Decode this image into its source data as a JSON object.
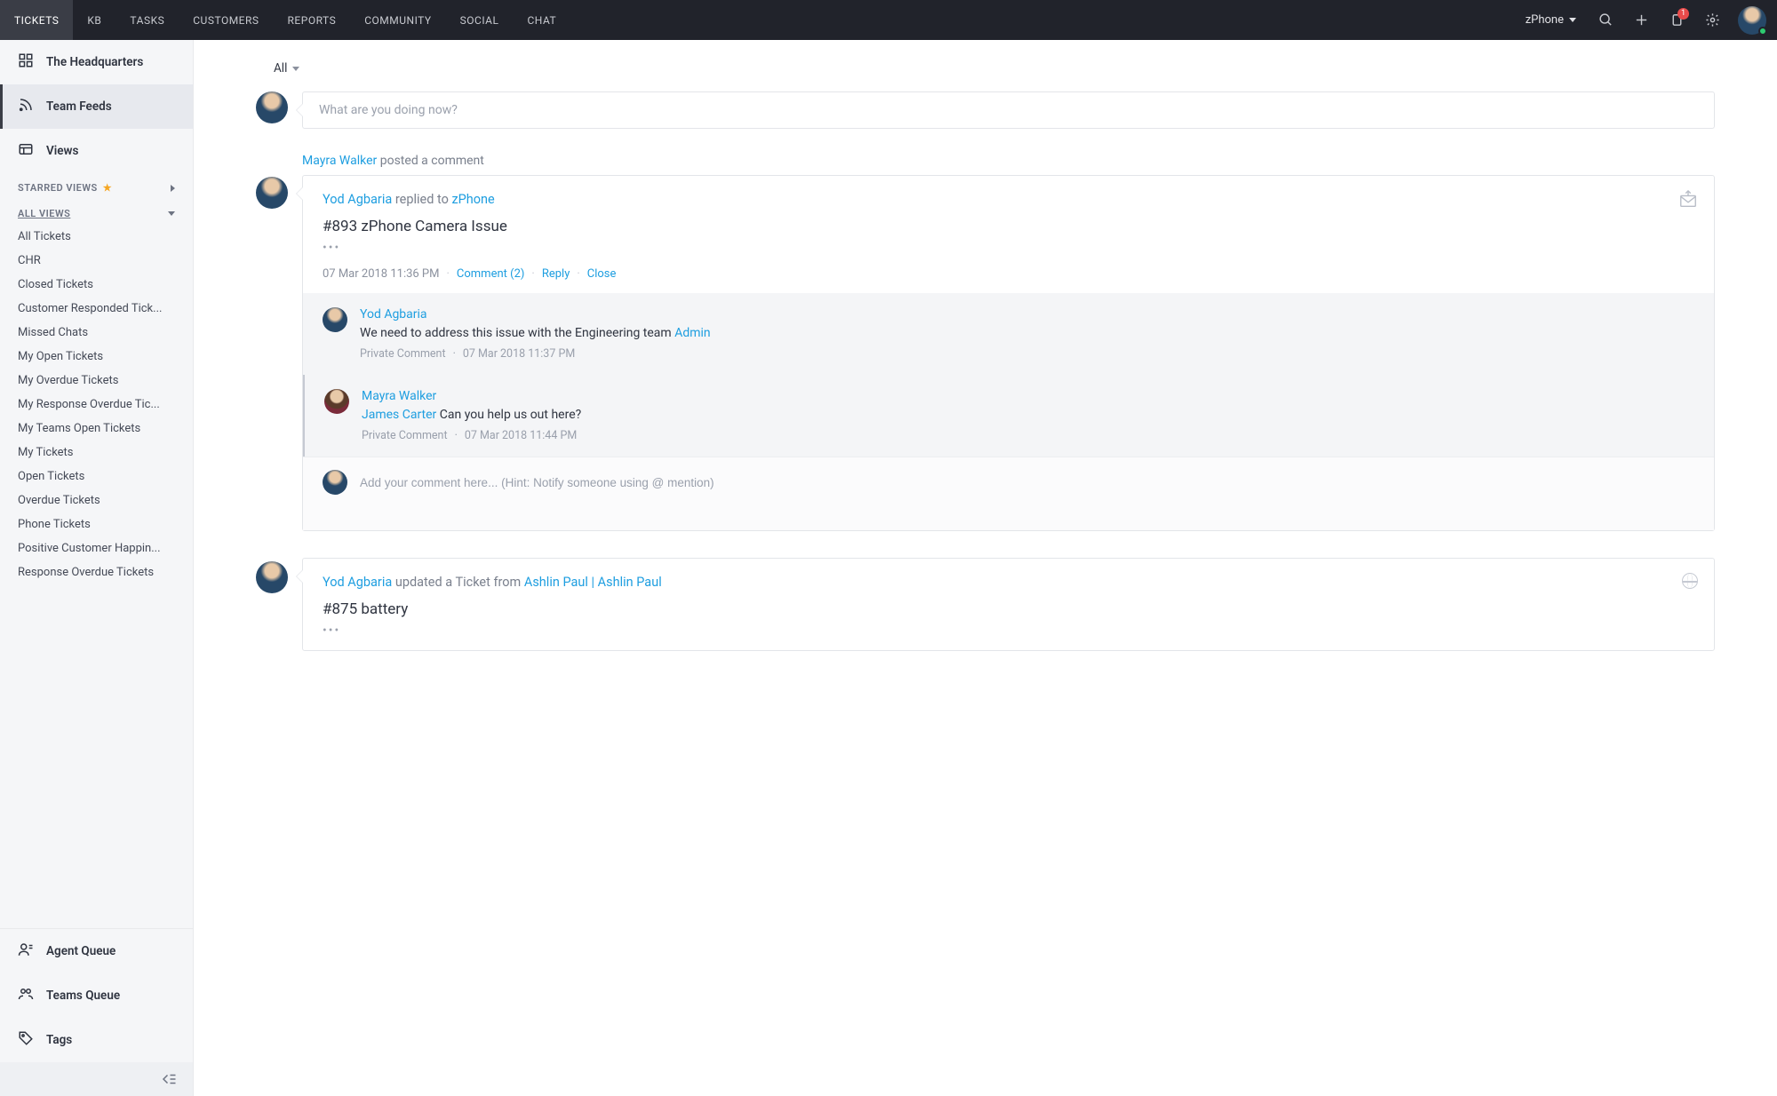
{
  "topnav": {
    "items": [
      "TICKETS",
      "KB",
      "TASKS",
      "CUSTOMERS",
      "REPORTS",
      "COMMUNITY",
      "SOCIAL",
      "CHAT"
    ],
    "active": 0,
    "brand": "zPhone",
    "notif_count": "1"
  },
  "sidebar": {
    "primary": [
      {
        "label": "The Headquarters",
        "icon": "grid"
      },
      {
        "label": "Team Feeds",
        "icon": "feed"
      },
      {
        "label": "Views",
        "icon": "views"
      }
    ],
    "activePrimary": 1,
    "starred_header": "STARRED VIEWS",
    "all_views_header": "ALL VIEWS",
    "views": [
      "All Tickets",
      "CHR",
      "Closed Tickets",
      "Customer Responded Tick...",
      "Missed Chats",
      "My Open Tickets",
      "My Overdue Tickets",
      "My Response Overdue Tic...",
      "My Teams Open Tickets",
      "My Tickets",
      "Open Tickets",
      "Overdue Tickets",
      "Phone Tickets",
      "Positive Customer Happin...",
      "Response Overdue Tickets"
    ],
    "queues": [
      {
        "label": "Agent Queue",
        "icon": "agent"
      },
      {
        "label": "Teams Queue",
        "icon": "team"
      },
      {
        "label": "Tags",
        "icon": "tag"
      }
    ]
  },
  "main": {
    "filter": "All",
    "compose_placeholder": "What are you doing now?",
    "posts": [
      {
        "pre_author": "Mayra Walker",
        "pre_action": " posted a comment",
        "author": "Yod Agbaria",
        "verb": " replied to ",
        "target": "zPhone",
        "title": "#893 zPhone Camera Issue",
        "ellipsis": "•••",
        "timestamp": "07 Mar 2018 11:36 PM",
        "comment_action": "Comment (2)",
        "reply_action": "Reply",
        "close_action": "Close",
        "icon": "mail-out",
        "comments": [
          {
            "author": "Yod Agbaria",
            "text_pre": "We need to address this issue with the Engineering team ",
            "mention": "Admin",
            "text_post": "",
            "type": "Private Comment",
            "ts": "07 Mar 2018 11:37 PM",
            "avatar": "m"
          },
          {
            "author": "Mayra Walker",
            "text_pre": "",
            "mention": "James Carter",
            "text_post": " Can you help us out here?",
            "type": "Private Comment",
            "ts": "07 Mar 2018 11:44 PM",
            "avatar": "f"
          }
        ],
        "add_placeholder": "Add your comment here... (Hint: Notify someone using @ mention)"
      },
      {
        "author": "Yod Agbaria",
        "verb": " updated a Ticket from ",
        "target": "Ashlin Paul | Ashlin Paul",
        "title": "#875 battery",
        "ellipsis": "•••",
        "icon": "globe"
      }
    ]
  }
}
